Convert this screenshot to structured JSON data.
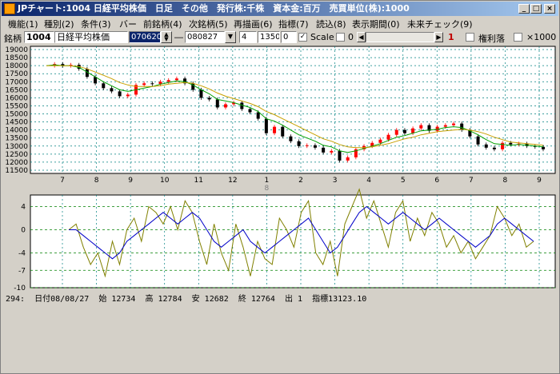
{
  "window": {
    "title": "JPチャート:1004 日経平均株価　日足　その他　発行株:千株　資本金:百万　売買単位(株):1000"
  },
  "menu": {
    "items": [
      "機能(1)",
      "種別(2)",
      "条件(3)",
      "バー",
      "前銘柄(4)",
      "次銘柄(5)",
      "再描画(6)",
      "指標(7)",
      "読込(8)",
      "表示期間(0)",
      "未来チェック(9)"
    ]
  },
  "toolbar": {
    "code_label": "銘柄",
    "code_value": "1004",
    "name_value": "日経平均株価",
    "from_date": "070620",
    "dash": "―",
    "to_date": "080827",
    "days_value": "4",
    "price_value": "1350",
    "zero_value": "0",
    "scale_label": "Scale",
    "scale_value": "0",
    "right_value": "1",
    "kenri_label": "権利落",
    "x1000_label": "×1000"
  },
  "colors": {
    "accent": "#0a246a",
    "grid": "#008080",
    "up": "#ff0000",
    "down": "#000000",
    "ma_short": "#00a000",
    "ma_long": "#c8a000",
    "osc1": "#0000c8",
    "osc2": "#808000"
  },
  "chart_data": [
    {
      "type": "line",
      "yticks": [
        11500,
        12000,
        12500,
        13000,
        13500,
        14000,
        14500,
        15000,
        15500,
        16000,
        16500,
        17000,
        17500,
        18000,
        18500,
        19000
      ],
      "ylim": [
        11300,
        19200
      ],
      "xticks": [
        "7",
        "8",
        "9",
        "10",
        "11",
        "12",
        "1",
        "2",
        "3",
        "4",
        "5",
        "6",
        "7",
        "8",
        "9"
      ],
      "year_label": "8",
      "series": [
        {
          "values": [
            18000,
            18100,
            18000,
            18050,
            17800,
            17300,
            16900,
            16600,
            16400,
            16100,
            16200,
            16800,
            16900,
            16850,
            17000,
            17100,
            17200,
            16900,
            16500,
            16000,
            15900,
            15400,
            15600,
            15700,
            15300,
            15100,
            14700,
            13800,
            14200,
            13600,
            13300,
            13000,
            13050,
            12900,
            12600,
            12700,
            12100,
            12300,
            12800,
            13000,
            13200,
            13400,
            13700,
            14000,
            13800,
            14100,
            14300,
            13950,
            14200,
            14300,
            14400,
            14000,
            13600,
            13100,
            12900,
            12800,
            13200,
            13100,
            13150,
            13000,
            12950,
            12800
          ]
        },
        {
          "values": [
            18000,
            18050,
            18000,
            18000,
            17900,
            17600,
            17300,
            17000,
            16750,
            16500,
            16400,
            16500,
            16600,
            16700,
            16850,
            16950,
            17050,
            17000,
            16800,
            16500,
            16250,
            15900,
            15800,
            15700,
            15550,
            15400,
            15150,
            14700,
            14550,
            14300,
            14000,
            13700,
            13500,
            13300,
            13050,
            12950,
            12700,
            12600,
            12700,
            12850,
            13000,
            13150,
            13350,
            13550,
            13650,
            13800,
            13950,
            14000,
            14050,
            14150,
            14200,
            14150,
            13950,
            13700,
            13400,
            13150,
            13100,
            13050,
            13100,
            13050,
            13000,
            12950
          ]
        },
        {
          "values": [
            18000,
            18000,
            18000,
            18000,
            17950,
            17800,
            17600,
            17400,
            17200,
            16950,
            16800,
            16700,
            16700,
            16700,
            16750,
            16850,
            16900,
            16950,
            16900,
            16750,
            16550,
            16300,
            16100,
            15950,
            15800,
            15650,
            15450,
            15150,
            14950,
            14700,
            14450,
            14200,
            13950,
            13700,
            13450,
            13300,
            13100,
            12950,
            12900,
            12900,
            12950,
            13050,
            13150,
            13300,
            13450,
            13550,
            13700,
            13800,
            13900,
            13950,
            14000,
            14050,
            14000,
            13900,
            13750,
            13550,
            13400,
            13250,
            13200,
            13150,
            13100,
            13050
          ]
        }
      ]
    },
    {
      "type": "line",
      "yticks": [
        4,
        0,
        -4,
        -7,
        -10
      ],
      "ylim": [
        -10,
        6
      ],
      "series": [
        {
          "values": [
            0,
            0,
            -1,
            -2,
            -3,
            -4,
            -5,
            -4,
            -2,
            -1,
            0,
            1,
            2,
            3,
            2,
            1,
            2,
            3,
            2,
            0,
            -2,
            -3,
            -2,
            -1,
            0,
            -2,
            -3,
            -4,
            -3,
            -2,
            -1,
            0,
            1,
            2,
            0,
            -2,
            -4,
            -3,
            -1,
            1,
            3,
            4,
            3,
            2,
            1,
            2,
            3,
            2,
            1,
            0,
            1,
            2,
            1,
            0,
            -1,
            -2,
            -3,
            -2,
            -1,
            1,
            2,
            1,
            0,
            -1,
            -2
          ]
        },
        {
          "values": [
            0,
            1,
            -3,
            -6,
            -4,
            -8,
            -2,
            -6,
            0,
            2,
            -2,
            4,
            3,
            1,
            4,
            0,
            5,
            3,
            -2,
            -6,
            1,
            -4,
            -7,
            1,
            -3,
            -8,
            -2,
            -5,
            -6,
            2,
            0,
            -3,
            3,
            5,
            -4,
            -6,
            -2,
            -8,
            1,
            4,
            7,
            2,
            5,
            1,
            -3,
            3,
            5,
            -2,
            2,
            -1,
            3,
            1,
            -3,
            -1,
            -4,
            -2,
            -5,
            -3,
            -1,
            4,
            2,
            -1,
            1,
            -3,
            -2
          ]
        }
      ]
    }
  ],
  "status": {
    "text": "294:  日付08/08/27  始 12734  高 12784  安 12682  終 12764  出 1  指標13123.10"
  }
}
